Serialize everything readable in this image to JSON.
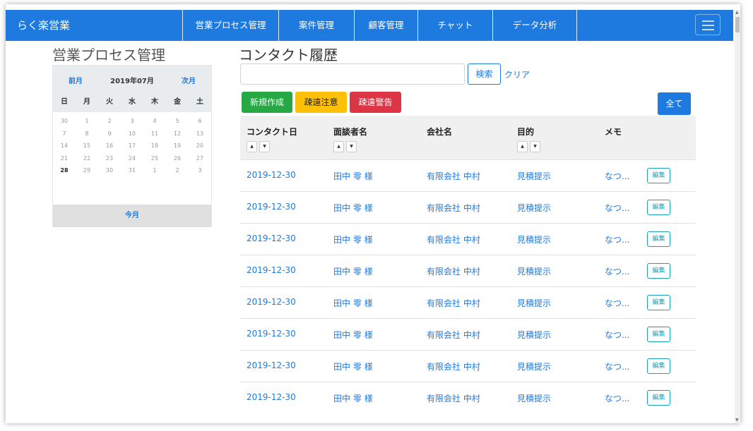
{
  "app": {
    "brand": "らく楽営業",
    "nav": [
      "営業プロセス管理",
      "案件管理",
      "顧客管理",
      "チャット",
      "データ分析"
    ]
  },
  "sidebar": {
    "title": "営業プロセス管理",
    "calendar": {
      "prev": "前月",
      "month": "2019年07月",
      "next": "次月",
      "weekdays": [
        "日",
        "月",
        "火",
        "水",
        "木",
        "金",
        "土"
      ],
      "weeks": [
        [
          "30",
          "1",
          "2",
          "3",
          "4",
          "5",
          "6"
        ],
        [
          "7",
          "8",
          "9",
          "10",
          "11",
          "12",
          "13"
        ],
        [
          "14",
          "15",
          "16",
          "17",
          "18",
          "19",
          "20"
        ],
        [
          "21",
          "22",
          "23",
          "24",
          "25",
          "26",
          "27"
        ],
        [
          "28",
          "29",
          "30",
          "31",
          "1",
          "2",
          "3"
        ]
      ],
      "today_day": "28",
      "this_month": "今月"
    }
  },
  "main": {
    "title": "コンタクト履歴",
    "search_value": "",
    "search_button": "検索",
    "clear": "クリア",
    "buttons": {
      "new": "新規作成",
      "caution": "疎遠注意",
      "warning": "疎遠警告",
      "all": "全て"
    },
    "columns": [
      "コンタクト日",
      "面談者名",
      "会社名",
      "目的",
      "メモ"
    ],
    "sort_up": "▲",
    "sort_down": "▼",
    "rows": [
      {
        "date": "2019-12-30",
        "person": "田中 零 様",
        "company": "有限会社 中村",
        "purpose": "見積提示",
        "memo": "なつ...",
        "edit": "編集"
      },
      {
        "date": "2019-12-30",
        "person": "田中 零 様",
        "company": "有限会社 中村",
        "purpose": "見積提示",
        "memo": "なつ...",
        "edit": "編集"
      },
      {
        "date": "2019-12-30",
        "person": "田中 零 様",
        "company": "有限会社 中村",
        "purpose": "見積提示",
        "memo": "なつ...",
        "edit": "編集"
      },
      {
        "date": "2019-12-30",
        "person": "田中 零 様",
        "company": "有限会社 中村",
        "purpose": "見積提示",
        "memo": "なつ...",
        "edit": "編集"
      },
      {
        "date": "2019-12-30",
        "person": "田中 零 様",
        "company": "有限会社 中村",
        "purpose": "見積提示",
        "memo": "なつ...",
        "edit": "編集"
      },
      {
        "date": "2019-12-30",
        "person": "田中 零 様",
        "company": "有限会社 中村",
        "purpose": "見積提示",
        "memo": "なつ...",
        "edit": "編集"
      },
      {
        "date": "2019-12-30",
        "person": "田中 零 様",
        "company": "有限会社 中村",
        "purpose": "見積提示",
        "memo": "なつ...",
        "edit": "編集"
      },
      {
        "date": "2019-12-30",
        "person": "田中 零 様",
        "company": "有限会社 中村",
        "purpose": "見積提示",
        "memo": "なつ...",
        "edit": "編集"
      }
    ]
  },
  "icons": {
    "menu": "hamburger-menu-icon",
    "sort": "sort-arrow-icon"
  },
  "colors": {
    "primary": "#1f7ae0",
    "success": "#28a745",
    "caution": "#ffc107",
    "danger": "#dc3545",
    "info": "#17a2b8"
  }
}
